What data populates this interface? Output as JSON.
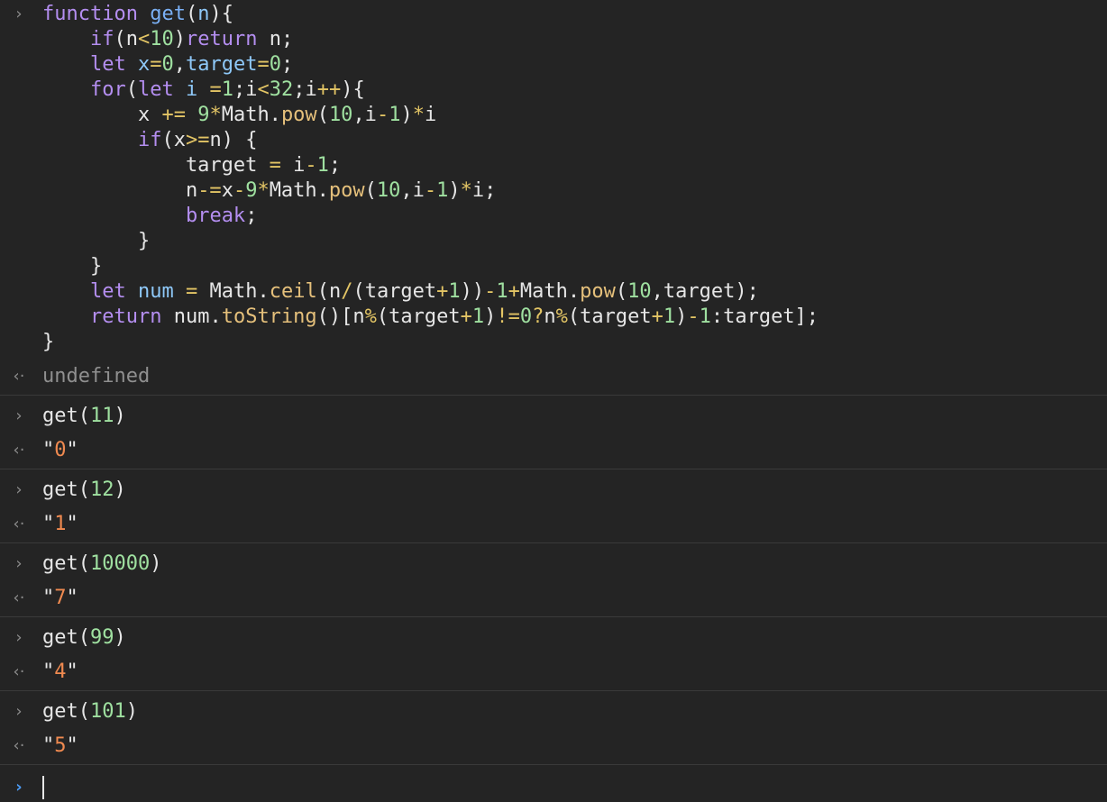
{
  "console": {
    "colors": {
      "background": "#242424",
      "keyword": "#b48ef0",
      "function_name": "#7ab0f5",
      "method": "#e5c07b",
      "operator": "#e3c565",
      "number": "#9fe0a0",
      "string_value": "#f08a50",
      "undefined": "#8f8f8f",
      "prompt_active": "#4b9bf5"
    },
    "code_lines": [
      [
        [
          "kw",
          "function "
        ],
        [
          "fd",
          "get"
        ],
        [
          "p",
          "("
        ],
        [
          "pa",
          "n"
        ],
        [
          "p",
          "){"
        ]
      ],
      [
        [
          "p",
          "    "
        ],
        [
          "kw",
          "if"
        ],
        [
          "p",
          "(n"
        ],
        [
          "op",
          "<"
        ],
        [
          "nm",
          "10"
        ],
        [
          "p",
          ")"
        ],
        [
          "kw",
          "return"
        ],
        [
          "p",
          " n;"
        ]
      ],
      [
        [
          "p",
          "    "
        ],
        [
          "kw",
          "let"
        ],
        [
          "p",
          " "
        ],
        [
          "pa",
          "x"
        ],
        [
          "op",
          "="
        ],
        [
          "nm",
          "0"
        ],
        [
          "p",
          ","
        ],
        [
          "pa",
          "target"
        ],
        [
          "op",
          "="
        ],
        [
          "nm",
          "0"
        ],
        [
          "p",
          ";"
        ]
      ],
      [
        [
          "p",
          "    "
        ],
        [
          "kw",
          "for"
        ],
        [
          "p",
          "("
        ],
        [
          "kw",
          "let"
        ],
        [
          "p",
          " "
        ],
        [
          "pa",
          "i"
        ],
        [
          "p",
          " "
        ],
        [
          "op",
          "="
        ],
        [
          "nm",
          "1"
        ],
        [
          "p",
          ";i"
        ],
        [
          "op",
          "<"
        ],
        [
          "nm",
          "32"
        ],
        [
          "p",
          ";i"
        ],
        [
          "op",
          "++"
        ],
        [
          "p",
          "){"
        ]
      ],
      [
        [
          "p",
          "        x "
        ],
        [
          "op",
          "+="
        ],
        [
          "p",
          " "
        ],
        [
          "nm",
          "9"
        ],
        [
          "op",
          "*"
        ],
        [
          "p",
          "Math."
        ],
        [
          "fn",
          "pow"
        ],
        [
          "p",
          "("
        ],
        [
          "nm",
          "10"
        ],
        [
          "p",
          ",i"
        ],
        [
          "op",
          "-"
        ],
        [
          "nm",
          "1"
        ],
        [
          "p",
          ")"
        ],
        [
          "op",
          "*"
        ],
        [
          "p",
          "i"
        ]
      ],
      [
        [
          "p",
          "        "
        ],
        [
          "kw",
          "if"
        ],
        [
          "p",
          "(x"
        ],
        [
          "op",
          ">="
        ],
        [
          "p",
          "n) {"
        ]
      ],
      [
        [
          "p",
          "            target "
        ],
        [
          "op",
          "="
        ],
        [
          "p",
          " i"
        ],
        [
          "op",
          "-"
        ],
        [
          "nm",
          "1"
        ],
        [
          "p",
          ";"
        ]
      ],
      [
        [
          "p",
          "            n"
        ],
        [
          "op",
          "-="
        ],
        [
          "p",
          "x"
        ],
        [
          "op",
          "-"
        ],
        [
          "nm",
          "9"
        ],
        [
          "op",
          "*"
        ],
        [
          "p",
          "Math."
        ],
        [
          "fn",
          "pow"
        ],
        [
          "p",
          "("
        ],
        [
          "nm",
          "10"
        ],
        [
          "p",
          ",i"
        ],
        [
          "op",
          "-"
        ],
        [
          "nm",
          "1"
        ],
        [
          "p",
          ")"
        ],
        [
          "op",
          "*"
        ],
        [
          "p",
          "i;"
        ]
      ],
      [
        [
          "p",
          "            "
        ],
        [
          "kw",
          "break"
        ],
        [
          "p",
          ";"
        ]
      ],
      [
        [
          "p",
          "        }"
        ]
      ],
      [
        [
          "p",
          "    }"
        ]
      ],
      [
        [
          "p",
          "    "
        ],
        [
          "kw",
          "let"
        ],
        [
          "p",
          " "
        ],
        [
          "pa",
          "num"
        ],
        [
          "p",
          " "
        ],
        [
          "op",
          "="
        ],
        [
          "p",
          " Math."
        ],
        [
          "fn",
          "ceil"
        ],
        [
          "p",
          "(n"
        ],
        [
          "op",
          "/"
        ],
        [
          "p",
          "(target"
        ],
        [
          "op",
          "+"
        ],
        [
          "nm",
          "1"
        ],
        [
          "p",
          "))"
        ],
        [
          "op",
          "-"
        ],
        [
          "nm",
          "1"
        ],
        [
          "op",
          "+"
        ],
        [
          "p",
          "Math."
        ],
        [
          "fn",
          "pow"
        ],
        [
          "p",
          "("
        ],
        [
          "nm",
          "10"
        ],
        [
          "p",
          ",target);"
        ]
      ],
      [
        [
          "p",
          "    "
        ],
        [
          "kw",
          "return"
        ],
        [
          "p",
          " num."
        ],
        [
          "fn",
          "toString"
        ],
        [
          "p",
          "()[n"
        ],
        [
          "op",
          "%"
        ],
        [
          "p",
          "(target"
        ],
        [
          "op",
          "+"
        ],
        [
          "nm",
          "1"
        ],
        [
          "p",
          ")"
        ],
        [
          "op",
          "!="
        ],
        [
          "nm",
          "0"
        ],
        [
          "op",
          "?"
        ],
        [
          "p",
          "n"
        ],
        [
          "op",
          "%"
        ],
        [
          "p",
          "(target"
        ],
        [
          "op",
          "+"
        ],
        [
          "nm",
          "1"
        ],
        [
          "p",
          ")"
        ],
        [
          "op",
          "-"
        ],
        [
          "nm",
          "1"
        ],
        [
          "p",
          ":target];"
        ]
      ],
      [
        [
          "p",
          "}"
        ]
      ]
    ],
    "first_result": "undefined",
    "prompt_symbol": "›",
    "result_symbol": "‹·",
    "calls": [
      {
        "fn": "get",
        "arg": "11",
        "result": "0"
      },
      {
        "fn": "get",
        "arg": "12",
        "result": "1"
      },
      {
        "fn": "get",
        "arg": "10000",
        "result": "7"
      },
      {
        "fn": "get",
        "arg": "99",
        "result": "4"
      },
      {
        "fn": "get",
        "arg": "101",
        "result": "5"
      }
    ],
    "input_value": ""
  }
}
